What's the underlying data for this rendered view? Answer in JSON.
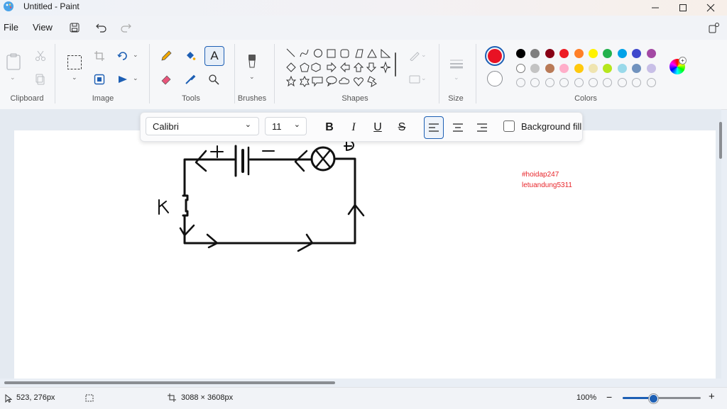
{
  "window": {
    "title": "Untitled - Paint",
    "icon": "paint-palette-icon",
    "controls": [
      "minimize-icon",
      "maximize-icon",
      "close-icon"
    ]
  },
  "menu": {
    "file": "File",
    "view": "View"
  },
  "quick_access": [
    "save-icon",
    "undo-icon",
    "redo-icon"
  ],
  "ribbon": {
    "groups": {
      "clipboard": "Clipboard",
      "image": "Image",
      "tools": "Tools",
      "brushes": "Brushes",
      "shapes": "Shapes",
      "size": "Size",
      "colors": "Colors"
    },
    "selected_tool": "text",
    "primary_color": "#e81224",
    "secondary_color": "#ffffff",
    "palette_row1": [
      "#000000",
      "#7f7f7f",
      "#880015",
      "#ed1c24",
      "#ff7f27",
      "#fff200",
      "#22b14c",
      "#00a2e8",
      "#3f48cc",
      "#a349a4"
    ],
    "palette_row2": [
      "#ffffff",
      "#c3c3c3",
      "#b97a57",
      "#ffaec9",
      "#ffc90e",
      "#efe4b0",
      "#b5e61d",
      "#99d9ea",
      "#7092be",
      "#c8bfe7"
    ]
  },
  "text_toolbar": {
    "font": "Calibri",
    "size": "11",
    "background_fill_label": "Background fill",
    "background_fill_checked": false,
    "alignment": "left"
  },
  "canvas": {
    "drawing_labels": {
      "switch": "K",
      "plus": "+",
      "minus": "−",
      "lamp": "Đ"
    },
    "watermark_line1": "#hoidap247",
    "watermark_line2": "letuandung5311",
    "watermark_color": "#e8262b"
  },
  "status": {
    "cursor_position": "523, 276px",
    "canvas_size": "3088 × 3608px",
    "zoom": "100%"
  }
}
